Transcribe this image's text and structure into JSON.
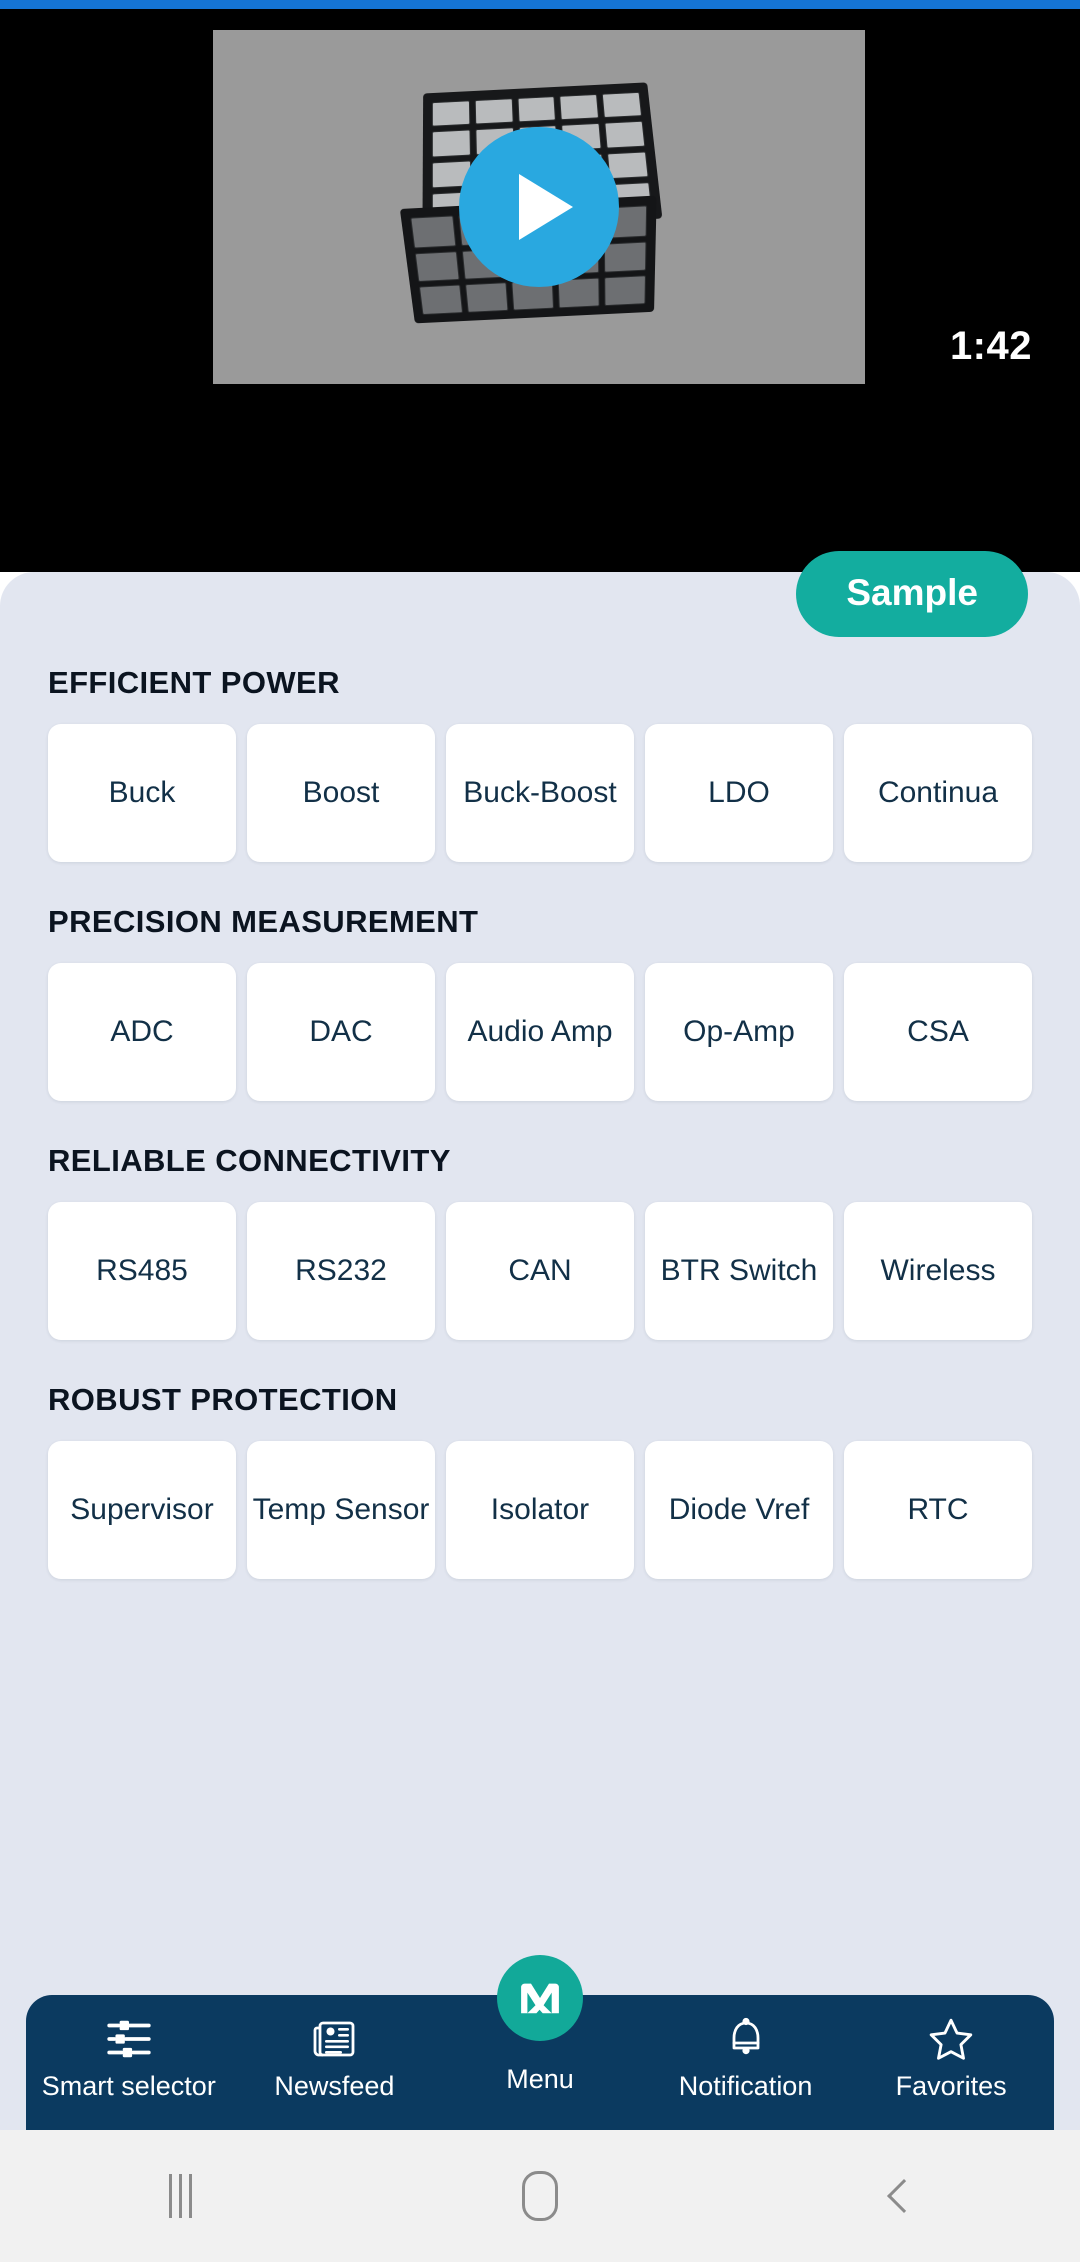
{
  "status": {
    "progress_color": "#1574d4"
  },
  "hero": {
    "video": {
      "play_icon": "play-icon",
      "duration": "1:42",
      "thumbnail_alt": "sample-kit-case"
    },
    "sample_button": {
      "label": "Sample",
      "color": "#13ad9f"
    }
  },
  "sections": [
    {
      "title": "EFFICIENT POWER",
      "cards": [
        "Buck",
        "Boost",
        "Buck-Boost",
        "LDO",
        "Continua"
      ]
    },
    {
      "title": "PRECISION MEASUREMENT",
      "cards": [
        "ADC",
        "DAC",
        "Audio Amp",
        "Op-Amp",
        "CSA"
      ]
    },
    {
      "title": "RELIABLE CONNECTIVITY",
      "cards": [
        "RS485",
        "RS232",
        "CAN",
        "BTR Switch",
        "Wireless"
      ]
    },
    {
      "title": "ROBUST PROTECTION",
      "cards": [
        "Supervisor",
        "Temp Sensor",
        "Isolator",
        "Diode Vref",
        "RTC"
      ]
    }
  ],
  "app_nav": {
    "background": "#0b3a60",
    "items": [
      {
        "label": "Smart selector",
        "icon": "sliders-icon"
      },
      {
        "label": "Newsfeed",
        "icon": "newspaper-icon"
      },
      {
        "label": "Menu",
        "icon": "maxim-logo-icon"
      },
      {
        "label": "Notification",
        "icon": "bell-icon"
      },
      {
        "label": "Favorites",
        "icon": "star-icon"
      }
    ]
  },
  "system_nav": {
    "recents": "recents-icon",
    "home": "home-icon",
    "back": "back-icon"
  }
}
